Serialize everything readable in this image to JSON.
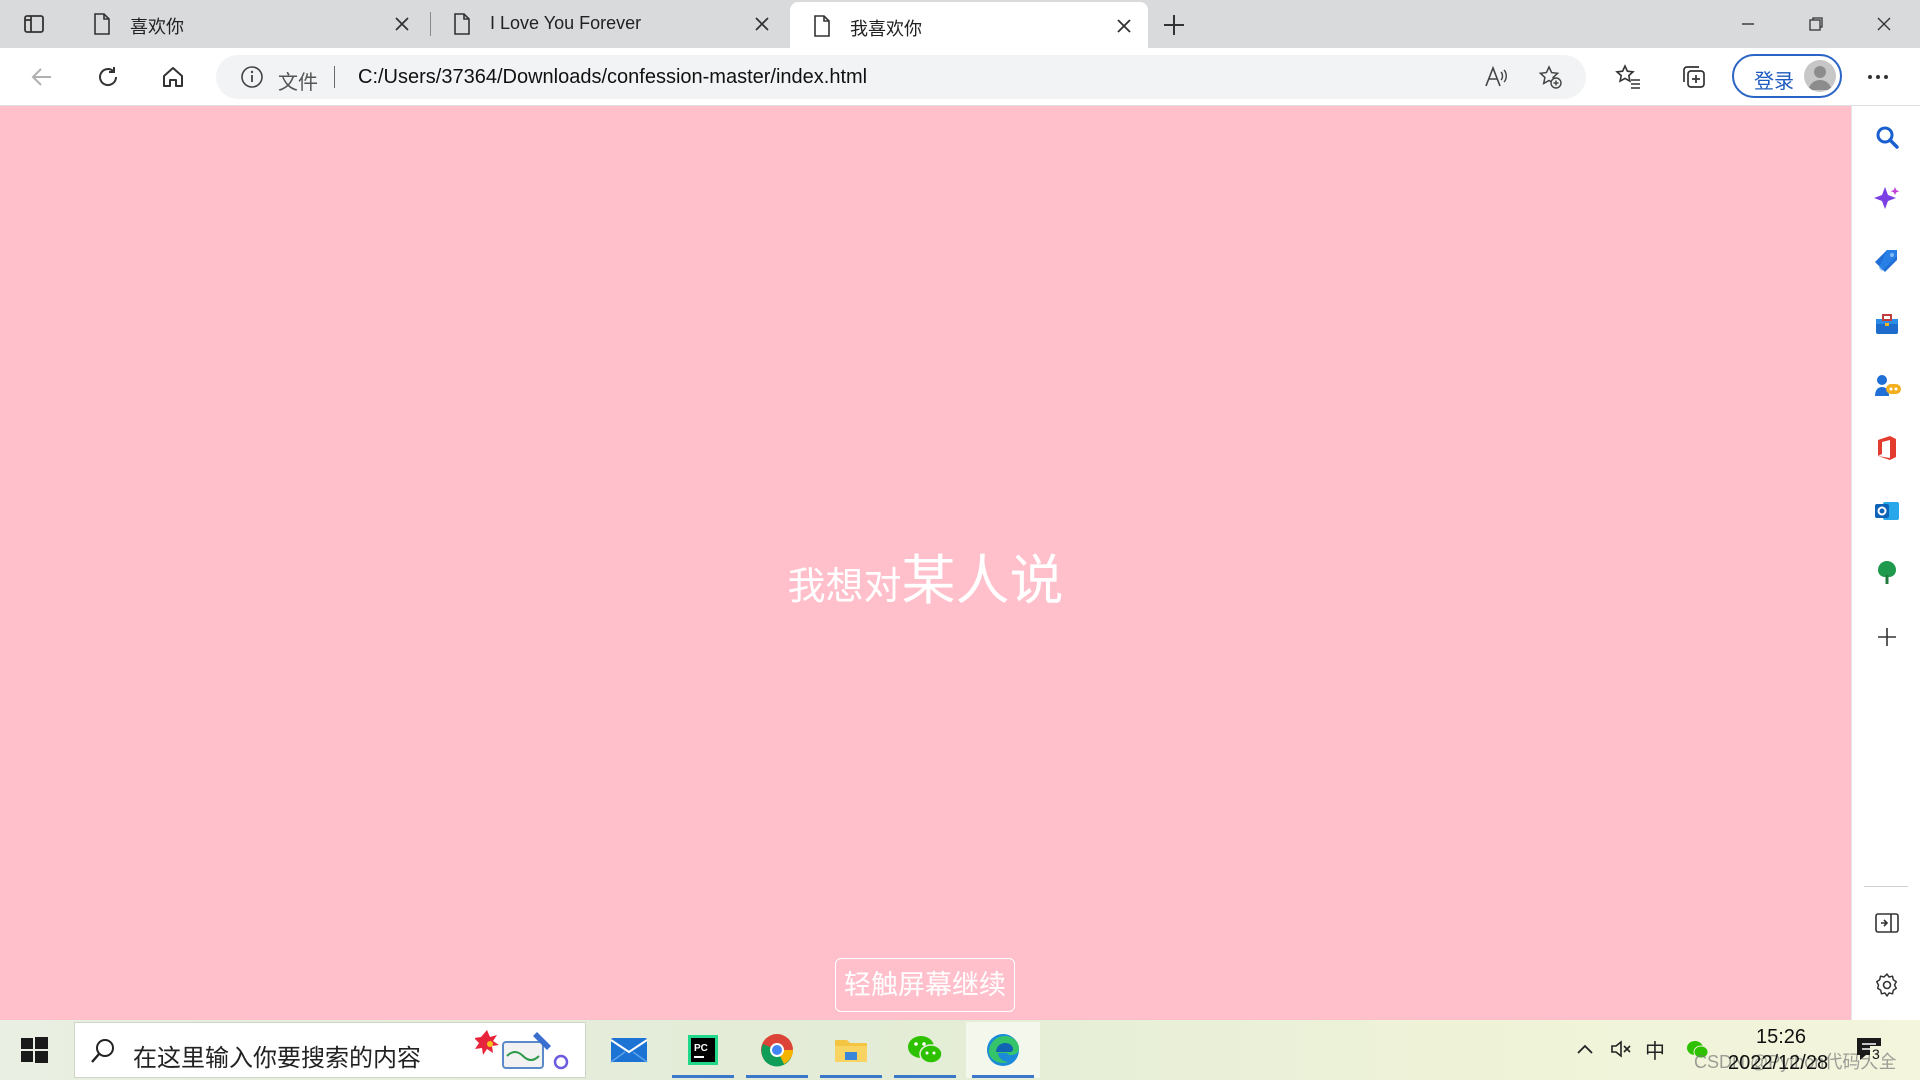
{
  "browser": {
    "tabs": [
      {
        "title": "喜欢你"
      },
      {
        "title": "I Love You Forever"
      },
      {
        "title": "我喜欢你",
        "active": true
      }
    ],
    "address": {
      "scheme_label": "文件",
      "url": "C:/Users/37364/Downloads/confession-master/index.html"
    },
    "signin_label": "登录"
  },
  "page": {
    "headline_small": "我想对",
    "headline_big": "某人说",
    "continue_label": "轻触屏幕继续",
    "background": "#ffc0cb"
  },
  "sidebar": {
    "icons": [
      "search-icon",
      "copilot-icon",
      "shopping-icon",
      "tools-icon",
      "games-icon",
      "office-icon",
      "outlook-icon",
      "tree-icon",
      "add-icon",
      "split-screen-icon",
      "settings-icon"
    ]
  },
  "taskbar": {
    "search_placeholder": "在这里输入你要搜索的内容",
    "apps": [
      "mail-icon",
      "pycharm-icon",
      "chrome-icon",
      "file-explorer-icon",
      "wechat-icon",
      "edge-icon"
    ],
    "tray": {
      "ime": "中",
      "time": "15:26",
      "date": "2022/12/28",
      "notification_count": "3",
      "watermark": "CSDN @Python代码大全"
    }
  }
}
